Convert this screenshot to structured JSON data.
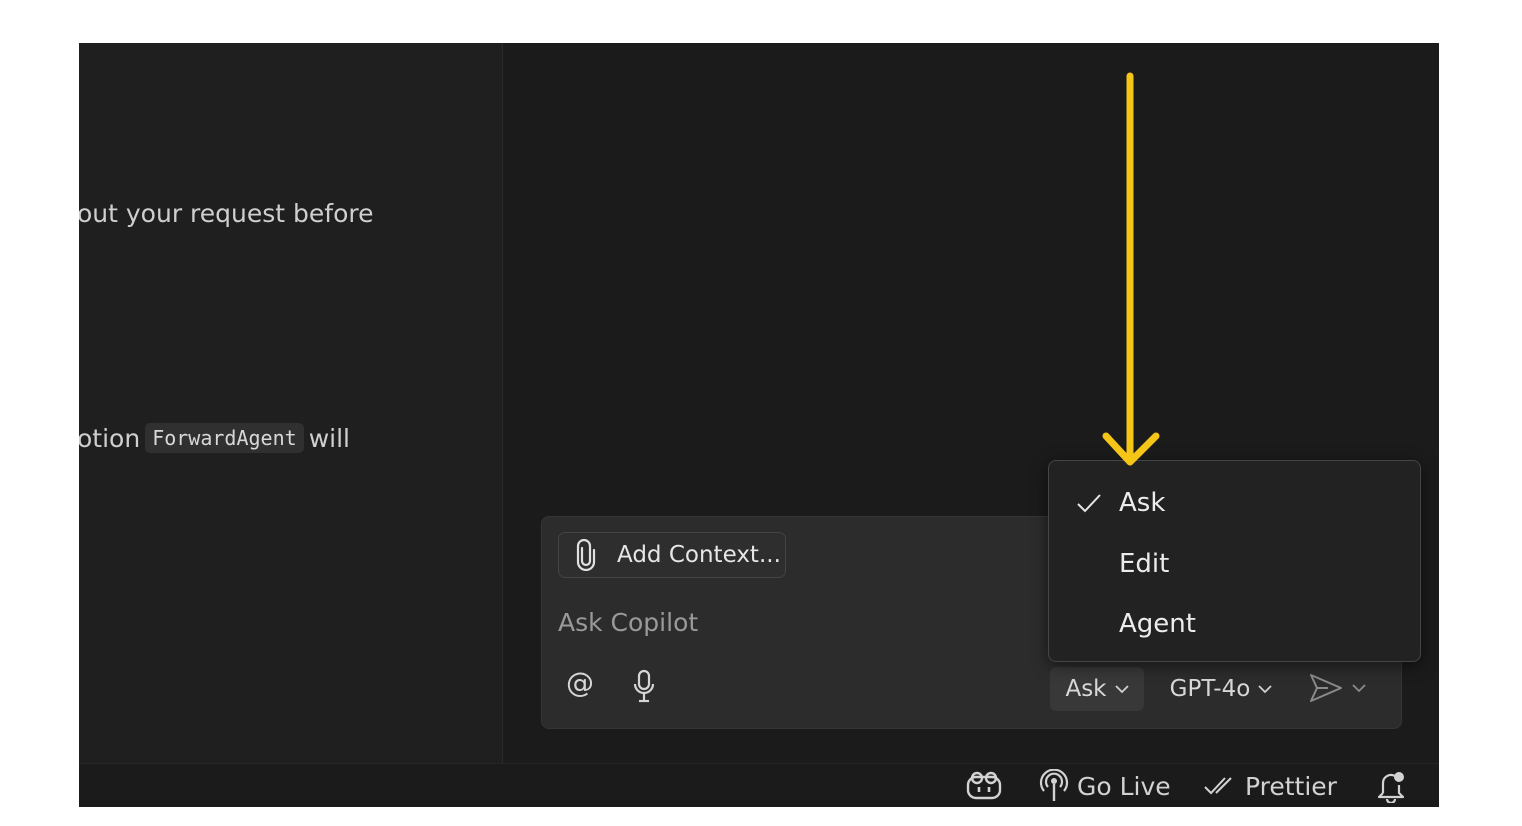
{
  "editor": {
    "line1": "out your request before",
    "line2_prefix": "otion",
    "line2_code": "ForwardAgent",
    "line2_suffix": "will"
  },
  "chat": {
    "add_context_label": "Add Context...",
    "input_placeholder": "Ask Copilot",
    "mode_label": "Ask",
    "model_label": "GPT-4o"
  },
  "mode_menu": {
    "items": [
      {
        "label": "Ask",
        "selected": true
      },
      {
        "label": "Edit",
        "selected": false
      },
      {
        "label": "Agent",
        "selected": false
      }
    ]
  },
  "status_bar": {
    "go_live": "Go Live",
    "prettier": "Prettier"
  },
  "colors": {
    "annotation_arrow": "#f5c518",
    "panel_bg": "#1b1b1b",
    "chat_bg": "#2c2c2c"
  },
  "icons": [
    "paperclip-icon",
    "at-icon",
    "microphone-icon",
    "chevron-down-icon",
    "send-icon",
    "check-icon",
    "copilot-icon",
    "broadcast-icon",
    "double-check-icon",
    "bell-icon"
  ]
}
